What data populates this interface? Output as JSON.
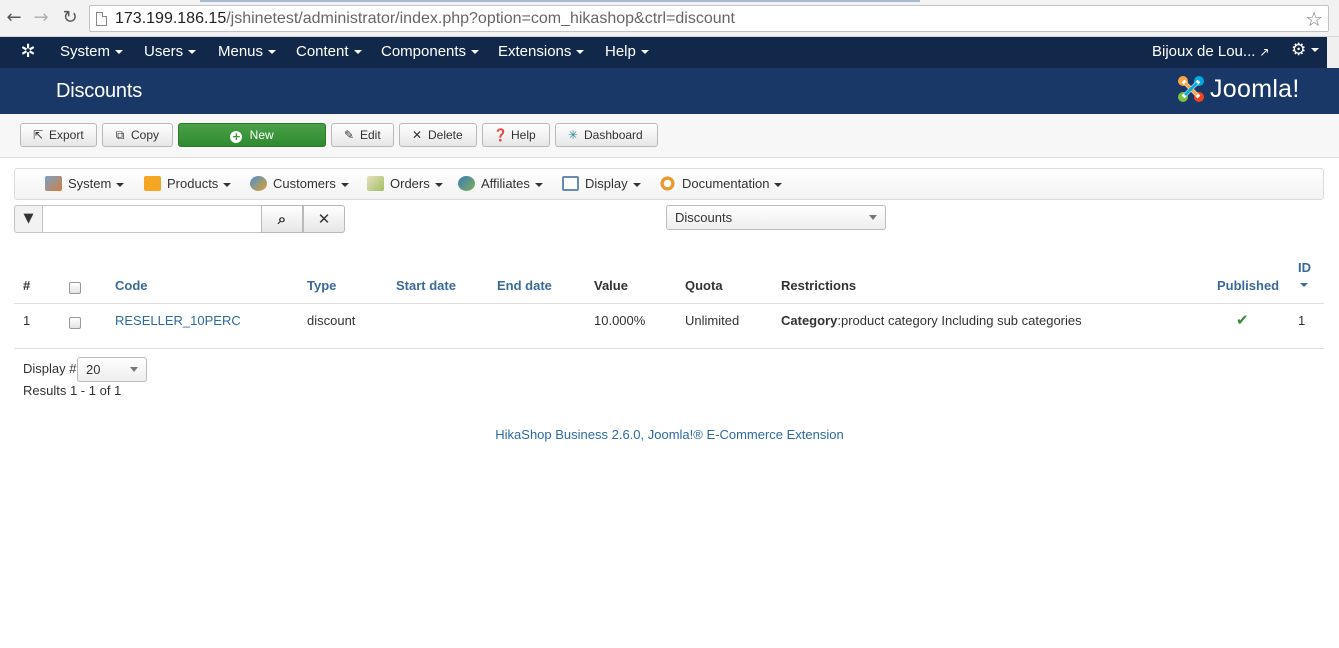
{
  "browser": {
    "url_host": "173.199.186.15",
    "url_path": "/jshinetest/administrator/index.php?option=com_hikashop&ctrl=discount"
  },
  "menubar": {
    "items": [
      {
        "label": "System"
      },
      {
        "label": "Users"
      },
      {
        "label": "Menus"
      },
      {
        "label": "Content"
      },
      {
        "label": "Components"
      },
      {
        "label": "Extensions"
      },
      {
        "label": "Help"
      }
    ],
    "site_name": "Bijoux de Lou..."
  },
  "header": {
    "title": "Discounts",
    "brand": "Joomla!",
    "brand_colors": [
      "#f9a541",
      "#7ac143",
      "#00a9e0",
      "#f44321"
    ]
  },
  "toolbar": {
    "export": "Export",
    "copy": "Copy",
    "new": "New",
    "edit": "Edit",
    "delete": "Delete",
    "help": "Help",
    "dashboard": "Dashboard"
  },
  "submenu": {
    "system": "System",
    "products": "Products",
    "customers": "Customers",
    "orders": "Orders",
    "affiliates": "Affiliates",
    "display": "Display",
    "documentation": "Documentation"
  },
  "filter": {
    "search_value": "",
    "type_select": "Discounts"
  },
  "table": {
    "headers": {
      "num": "#",
      "code": "Code",
      "type": "Type",
      "start_date": "Start date",
      "end_date": "End date",
      "value": "Value",
      "quota": "Quota",
      "restrictions": "Restrictions",
      "published": "Published",
      "id": "ID"
    },
    "rows": [
      {
        "num": "1",
        "code": "RESELLER_10PERC",
        "type": "discount",
        "start_date": "",
        "end_date": "",
        "value": "10.000%",
        "quota": "Unlimited",
        "restriction_label": "Category",
        "restriction_text": ":product category Including sub categories",
        "published": true,
        "id": "1"
      }
    ]
  },
  "pagination": {
    "display_label": "Display #",
    "display_value": "20",
    "results": "Results 1 - 1 of 1"
  },
  "footer": {
    "text": "HikaShop Business 2.6.0, Joomla!® E-Commerce Extension"
  },
  "colors": {
    "menubar_bg": "#12284a",
    "header_bg": "#1a3867",
    "new_button": "#3a963a",
    "link": "#2c6aa0"
  }
}
